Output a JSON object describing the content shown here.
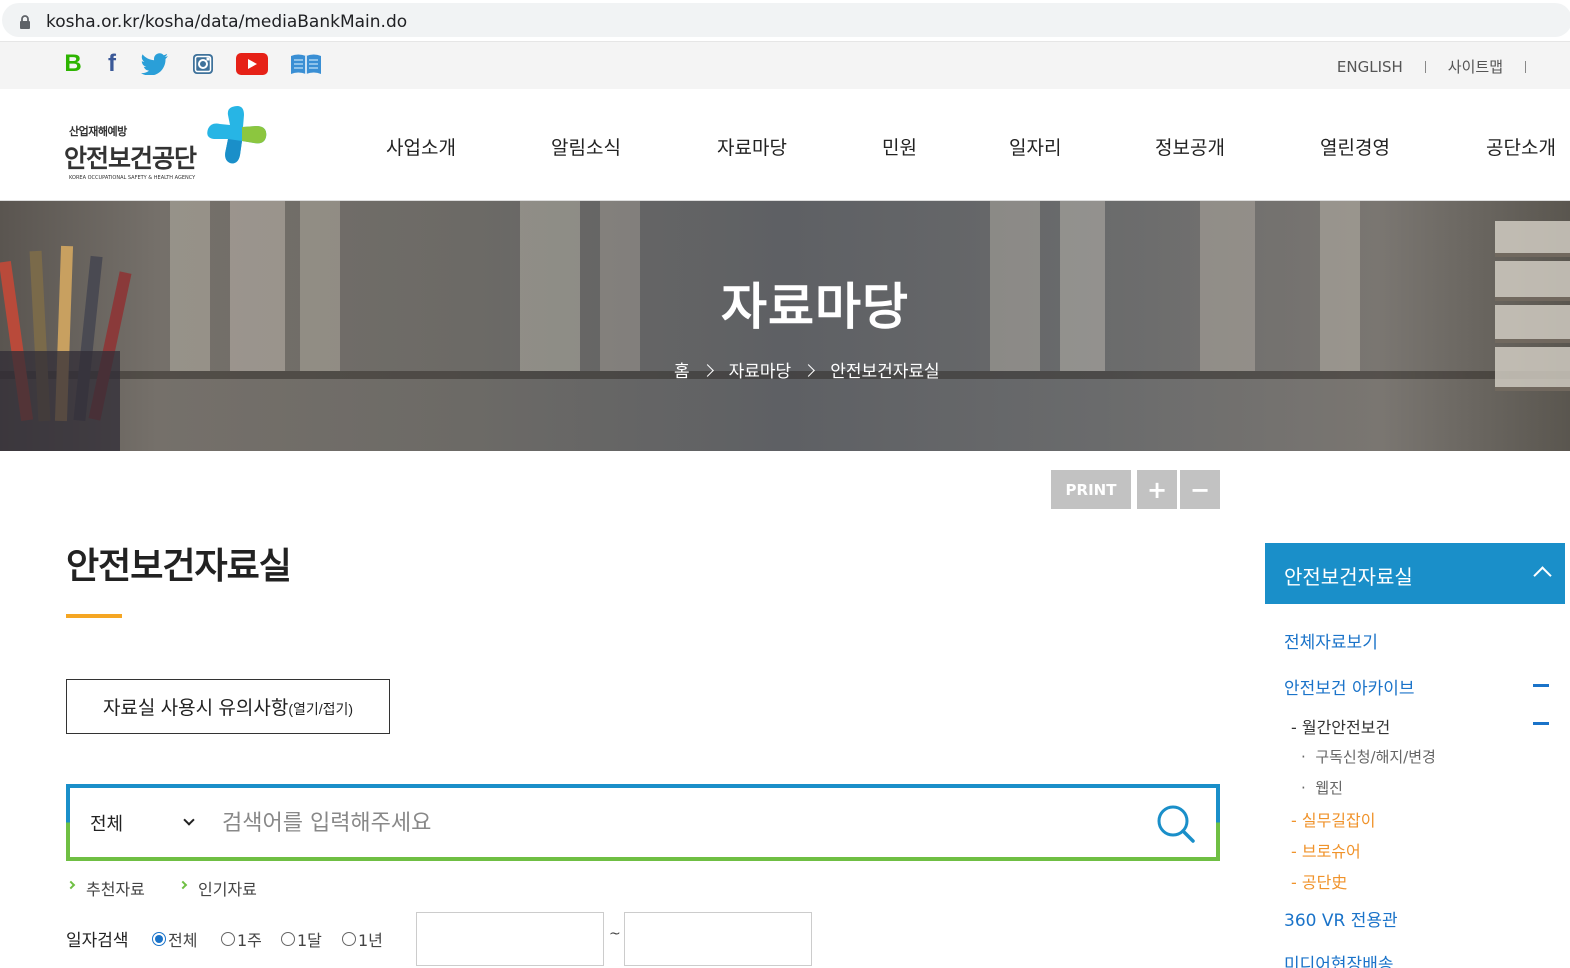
{
  "browser": {
    "url": "kosha.or.kr/kosha/data/mediaBankMain.do"
  },
  "utility": {
    "sns": [
      "blog-icon",
      "facebook-icon",
      "twitter-icon",
      "instagram-icon",
      "youtube-icon",
      "ebook-icon"
    ],
    "english": "ENGLISH",
    "sitemap": "사이트맵"
  },
  "logo": {
    "small": "산업재해예방",
    "big": "안전보건공단",
    "eng": "KOREA OCCUPATIONAL SAFETY & HEALTH AGENCY"
  },
  "gnb": [
    "사업소개",
    "알림소식",
    "자료마당",
    "민원",
    "일자리",
    "정보공개",
    "열린경영",
    "공단소개"
  ],
  "banner": {
    "title": "자료마당",
    "breadcrumb": [
      "홈",
      "자료마당",
      "안전보건자료실"
    ]
  },
  "tools": {
    "print": "PRINT",
    "zoom_in": "+",
    "zoom_out": "−"
  },
  "content": {
    "title": "안전보건자료실",
    "notice_label": "자료실 사용시 유의사항",
    "notice_toggle": "(열기/접기)",
    "search": {
      "category": "전체",
      "placeholder": "검색어를 입력해주세요",
      "value": ""
    },
    "quick_links": [
      "추천자료",
      "인기자료"
    ],
    "date_search": {
      "label": "일자검색",
      "options": [
        "전체",
        "1주",
        "1달",
        "1년"
      ],
      "selected": "전체",
      "start": "",
      "end": "",
      "tilde": "~"
    }
  },
  "sidenav": {
    "title": "안전보건자료실",
    "items": {
      "all": "전체자료보기",
      "archive": "안전보건 아카이브",
      "monthly": "월간안전보건",
      "subscribe": "구독신청/해지/변경",
      "webzine": "웹진",
      "guide": "실무길잡이",
      "brochure": "브로슈어",
      "history": "공단史",
      "vr": "360 VR 전용관",
      "media": "미디어현장배송"
    }
  },
  "colors": {
    "primary": "#1a8fc9",
    "accent": "#f5a623",
    "green": "#6fbf43",
    "orange": "#f0932b"
  }
}
